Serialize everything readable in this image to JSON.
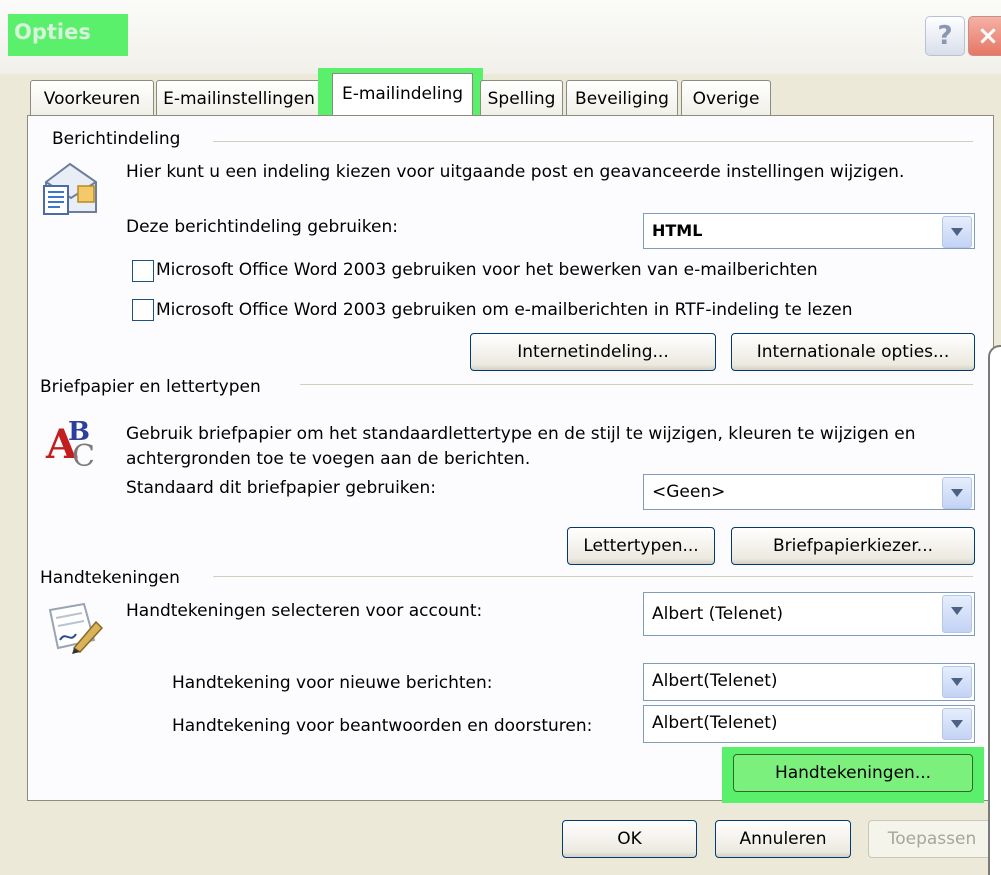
{
  "window": {
    "title": "Opties",
    "help_glyph": "?",
    "close_glyph": "×"
  },
  "tabs": [
    {
      "label": "Voorkeuren"
    },
    {
      "label": "E-mailinstellingen"
    },
    {
      "label": "E-mailindeling",
      "selected": true
    },
    {
      "label": "Spelling"
    },
    {
      "label": "Beveiliging"
    },
    {
      "label": "Overige"
    }
  ],
  "berichtindeling": {
    "title": "Berichtindeling",
    "description": "Hier kunt u een indeling kiezen voor uitgaande post en geavanceerde instellingen wijzigen.",
    "format_label": "Deze berichtindeling gebruiken:",
    "format_value": "HTML",
    "check_word_edit": "Microsoft Office Word 2003 gebruiken voor het bewerken van e-mailberichten",
    "check_word_rtf": "Microsoft Office Word 2003 gebruiken om e-mailberichten in RTF-indeling te lezen",
    "btn_internet": "Internetindeling...",
    "btn_intl": "Internationale opties..."
  },
  "briefpapier": {
    "title": "Briefpapier en lettertypen",
    "description_line1": "Gebruik briefpapier om het standaardlettertype en de stijl te wijzigen, kleuren te wijzigen en",
    "description_line2": "achtergronden toe te voegen aan de berichten.",
    "stationery_label": "Standaard dit briefpapier gebruiken:",
    "stationery_value": "<Geen>",
    "btn_fonts": "Lettertypen...",
    "btn_picker": "Briefpapierkiezer..."
  },
  "handtekeningen": {
    "title": "Handtekeningen",
    "account_label": "Handtekeningen selecteren voor account:",
    "account_value": "Albert (Telenet)",
    "new_label": "Handtekening voor nieuwe berichten:",
    "new_value": "Albert(Telenet)",
    "reply_label": "Handtekening voor beantwoorden en doorsturen:",
    "reply_value": "Albert(Telenet)",
    "btn_signatures": "Handtekeningen..."
  },
  "footer": {
    "ok": "OK",
    "cancel": "Annuleren",
    "apply": "Toepassen"
  },
  "colors": {
    "highlight": "#5bf06c",
    "dialog_bg": "#ece9d8",
    "panel_bg": "#fcfcfe"
  }
}
